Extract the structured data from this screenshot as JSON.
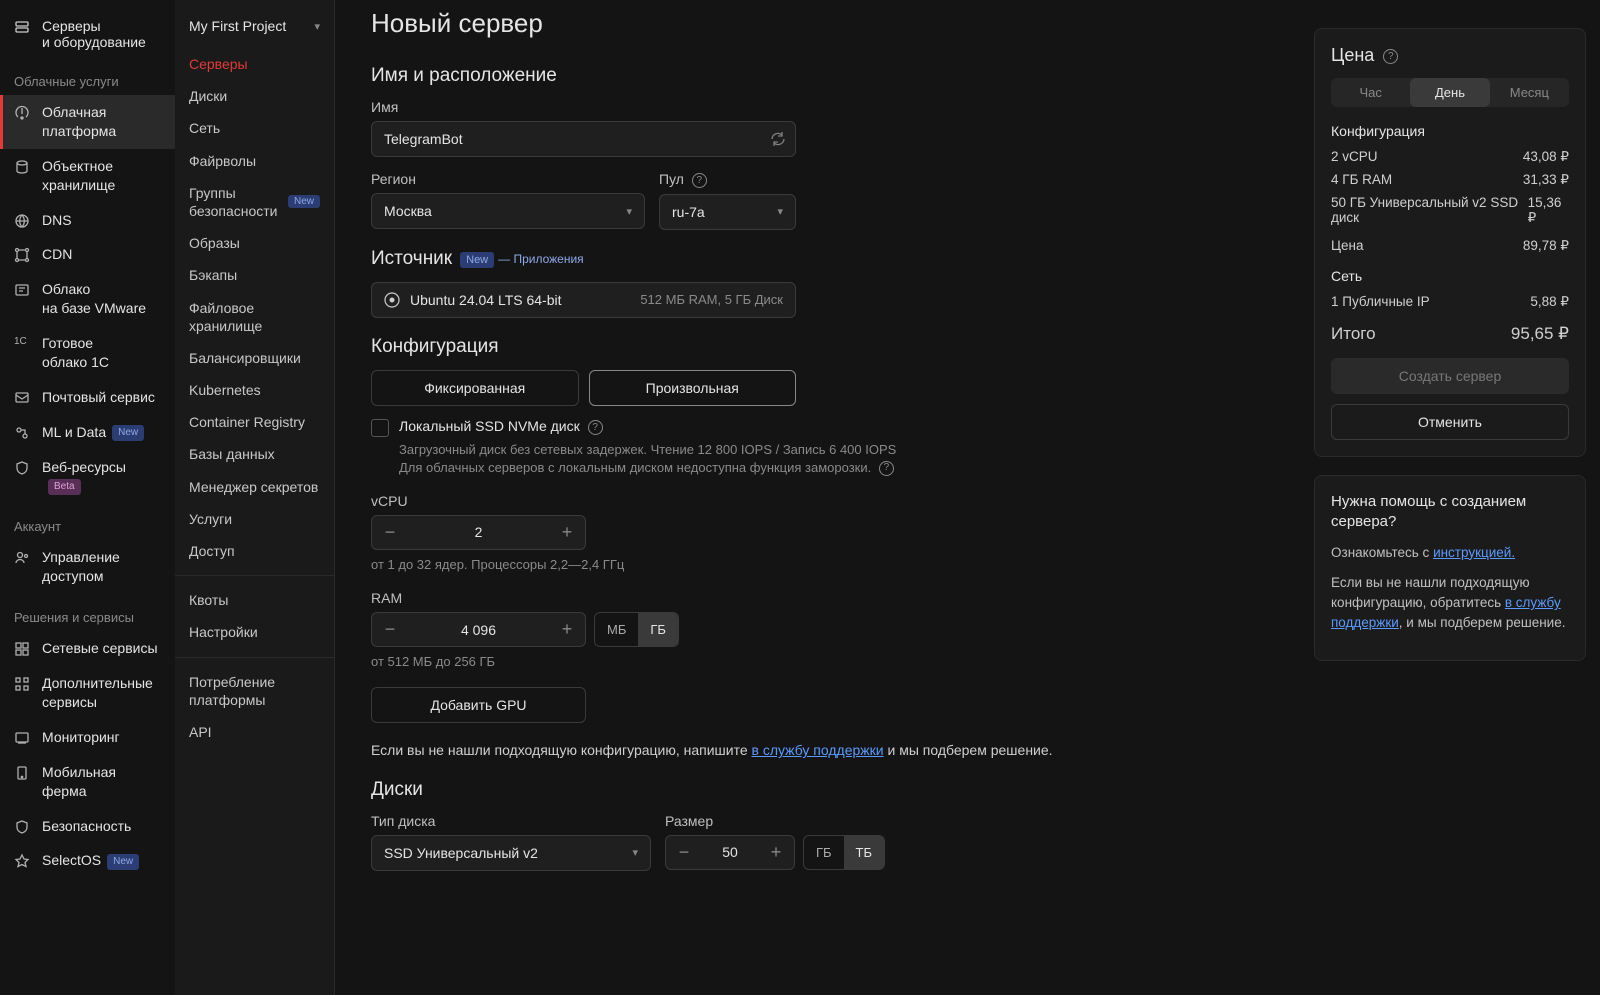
{
  "sidebar1": {
    "top": {
      "label": "Серверы\nи оборудование"
    },
    "sections": [
      {
        "title": "Облачные услуги",
        "items": [
          {
            "label": "Облачная\nплатформа",
            "active": true
          },
          {
            "label": "Объектное\nхранилище"
          },
          {
            "label": "DNS"
          },
          {
            "label": "CDN"
          },
          {
            "label": "Облако\nна базе VMware"
          },
          {
            "label": "Готовое\nоблако 1С",
            "icon_text": "1C"
          },
          {
            "label": "Почтовый сервис"
          },
          {
            "label": "ML и Data",
            "badge": "New",
            "badge_kind": "new"
          },
          {
            "label": "Веб-ресурсы",
            "badge": "Beta",
            "badge_kind": "beta"
          }
        ]
      },
      {
        "title": "Аккаунт",
        "items": [
          {
            "label": "Управление\nдоступом"
          }
        ]
      },
      {
        "title": "Решения и сервисы",
        "items": [
          {
            "label": "Сетевые сервисы"
          },
          {
            "label": "Дополнительные\nсервисы"
          },
          {
            "label": "Мониторинг"
          },
          {
            "label": "Мобильная ферма"
          },
          {
            "label": "Безопасность"
          },
          {
            "label": "SelectOS",
            "badge": "New",
            "badge_kind": "new"
          }
        ]
      }
    ]
  },
  "sidebar2": {
    "project": "My First Project",
    "items": [
      {
        "label": "Серверы",
        "active": true
      },
      {
        "label": "Диски"
      },
      {
        "label": "Сеть"
      },
      {
        "label": "Файрволы"
      },
      {
        "label": "Группы безопасности",
        "badge": "New"
      },
      {
        "label": "Образы"
      },
      {
        "label": "Бэкапы"
      },
      {
        "label": "Файловое хранилище"
      },
      {
        "label": "Балансировщики"
      },
      {
        "label": "Kubernetes"
      },
      {
        "label": "Container Registry"
      },
      {
        "label": "Базы данных"
      },
      {
        "label": "Менеджер секретов"
      },
      {
        "label": "Услуги"
      },
      {
        "label": "Доступ"
      }
    ],
    "bottom_items": [
      {
        "label": "Квоты"
      },
      {
        "label": "Настройки"
      }
    ],
    "bottom_items2": [
      {
        "label": "Потребление платформы"
      },
      {
        "label": "API"
      }
    ]
  },
  "main": {
    "title": "Новый сервер",
    "name_section": {
      "heading": "Имя и расположение",
      "name_label": "Имя",
      "name_value": "TelegramBot",
      "region_label": "Регион",
      "region_value": "Москва",
      "pool_label": "Пул",
      "pool_value": "ru-7a"
    },
    "source_section": {
      "heading": "Источник",
      "new_badge": "New",
      "new_text": "— Приложения",
      "os_name": "Ubuntu 24.04 LTS 64-bit",
      "os_meta": "512 МБ RAM, 5 ГБ Диск"
    },
    "config_section": {
      "heading": "Конфигурация",
      "fixed": "Фиксированная",
      "custom": "Произвольная",
      "nvme_label": "Локальный SSD NVMe диск",
      "nvme_hint1": "Загрузочный диск без сетевых задержек. Чтение 12 800 IOPS / Запись 6 400 IOPS",
      "nvme_hint2": "Для облачных серверов с локальным диском недоступна функция заморозки.",
      "vcpu_label": "vCPU",
      "vcpu_value": "2",
      "vcpu_hint": "от 1 до 32 ядер. Процессоры 2,2—2,4 ГГц",
      "ram_label": "RAM",
      "ram_value": "4 096",
      "ram_unit_mb": "МБ",
      "ram_unit_gb": "ГБ",
      "ram_hint": "от 512 МБ до 256 ГБ",
      "add_gpu": "Добавить GPU",
      "help_text_1": "Если вы не нашли подходящую конфигурацию, напишите ",
      "help_link": "в службу поддержки",
      "help_text_2": " и мы подберем решение."
    },
    "disks_section": {
      "heading": "Диски",
      "type_label": "Тип диска",
      "type_value": "SSD Универсальный v2",
      "size_label": "Размер",
      "size_value": "50",
      "unit_gb": "ГБ",
      "unit_tb": "ТБ"
    }
  },
  "right": {
    "price_heading": "Цена",
    "period_hour": "Час",
    "period_day": "День",
    "period_month": "Месяц",
    "config_heading": "Конфигурация",
    "lines": [
      {
        "label": "2 vCPU",
        "price": "43,08 ₽"
      },
      {
        "label": "4 ГБ RAM",
        "price": "31,33 ₽"
      },
      {
        "label": "50 ГБ Универсальный v2 SSD диск",
        "price": "15,36 ₽"
      }
    ],
    "subtotal_label": "Цена",
    "subtotal_price": "89,78 ₽",
    "network_heading": "Сеть",
    "network_lines": [
      {
        "label": "1 Публичные IP",
        "price": "5,88 ₽"
      }
    ],
    "total_label": "Итого",
    "total_price": "95,65 ₽",
    "create_btn": "Создать сервер",
    "cancel_btn": "Отменить",
    "help": {
      "title": "Нужна помощь с созданием сервера?",
      "p1_a": "Ознакомьтесь с ",
      "p1_link": "инструкцией.",
      "p2_a": "Если вы не нашли подходящую конфигурацию, обратитесь ",
      "p2_link": "в службу поддержки",
      "p2_b": ", и мы подберем решение."
    }
  }
}
